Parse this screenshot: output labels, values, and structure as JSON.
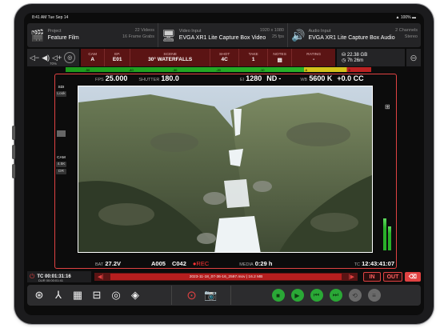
{
  "status": {
    "time": "8:41 AM  Tue Sep 14",
    "battery": "100%"
  },
  "info": {
    "project": {
      "label": "Project",
      "value": "Feature Film",
      "sub1": "22 Videos",
      "sub2": "16 Frame Grabs"
    },
    "video": {
      "label": "Video Input",
      "value": "EVGA XR1 Lite Capture Box Video",
      "sub1": "1920 x 1080",
      "sub2": "25 fps"
    },
    "audio": {
      "label": "Audio Input",
      "value": "EVGA XR1 Lite Capture Box Audio",
      "sub1": "2 Channels",
      "sub2": "Stereo"
    }
  },
  "volume": {
    "percent": "70%"
  },
  "slate": [
    {
      "label": "CAM",
      "value": "A"
    },
    {
      "label": "EP.",
      "value": "E01"
    },
    {
      "label": "SCENE",
      "value": "30° WATERFALLS"
    },
    {
      "label": "SHOT",
      "value": "4C"
    },
    {
      "label": "TAKE",
      "value": "1"
    },
    {
      "label": "NOTES",
      "value": "▤"
    },
    {
      "label": "RATING",
      "value": "-"
    }
  ],
  "media": {
    "free": "22.38 GB",
    "remaining": "7h 26m"
  },
  "meter_ticks": [
    "-50",
    "-40",
    "-30",
    "-20",
    "-10",
    "-6",
    "0"
  ],
  "monitor": {
    "fps_label": "FPS",
    "fps": "25.000",
    "shutter_label": "SHUTTER",
    "shutter": "180.0",
    "ei_label": "EI",
    "ei": "1280",
    "nd_label": "ND",
    "nd": "-",
    "wb_label": "WB",
    "wb": "5600 K",
    "cc": "+0.0 CC",
    "left_tags": [
      "SDI",
      "Look",
      "CAM",
      "4.5K",
      "DR"
    ],
    "bat_label": "BAT",
    "bat": "27.2V",
    "reel": "A005",
    "clip": "C042",
    "rec": "●REC",
    "media_label": "MEDIA",
    "media_time": "0:29 h",
    "tc_label": "TC",
    "tc": "12:43:41:07",
    "audio_channels": [
      "1",
      "2"
    ]
  },
  "timecode": {
    "label": "TC",
    "value": "00:01:31:16",
    "dur_label": "DUR",
    "duration": "00:00:01:41"
  },
  "clip_name": "2023-11-18_07-36-16_2597.mov  |  16.2 MB",
  "buttons": {
    "in": "IN",
    "out": "OUT"
  },
  "colors": {
    "accent_red": "#e04242",
    "slate_bg": "#5b1414",
    "play_green": "#2aa836"
  },
  "toolbar_icons": [
    "layers-icon",
    "graph-icon",
    "grid-icon",
    "split-icon",
    "aperture-icon",
    "stack-icon",
    "record-icon",
    "camera-icon",
    "stop-icon",
    "play-icon",
    "skip-back-icon",
    "skip-forward-icon",
    "loop-icon",
    "menu-icon"
  ]
}
